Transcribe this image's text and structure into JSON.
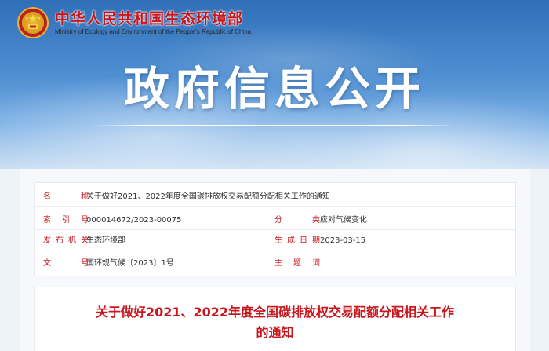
{
  "header": {
    "org_name_cn": "中华人民共和国生态环境部",
    "org_name_en": "Ministry of Ecology and Environment of the People's Republic of China",
    "banner_title": "政府信息公开"
  },
  "meta": {
    "name_label": "名　　称",
    "name_value": "关于做好2021、2022年度全国碳排放权交易配额分配相关工作的通知",
    "index_label": "索 引 号",
    "index_value": "000014672/2023-00075",
    "category_label": "分　　类",
    "category_value": "应对气候变化",
    "issuer_label": "发布机关",
    "issuer_value": "生态环境部",
    "date_label": "生成日期",
    "date_value": "2023-03-15",
    "docno_label": "文　　号",
    "docno_value": "国环规气候〔2023〕1号",
    "subject_label": "主 题 词",
    "subject_value": ""
  },
  "document": {
    "title_line1": "关于做好2021、2022年度全国碳排放权交易配额分配相关工作",
    "title_line2": "的通知"
  },
  "colors": {
    "accent_red": "#c8161d",
    "banner_blue": "#4f8fd2"
  }
}
